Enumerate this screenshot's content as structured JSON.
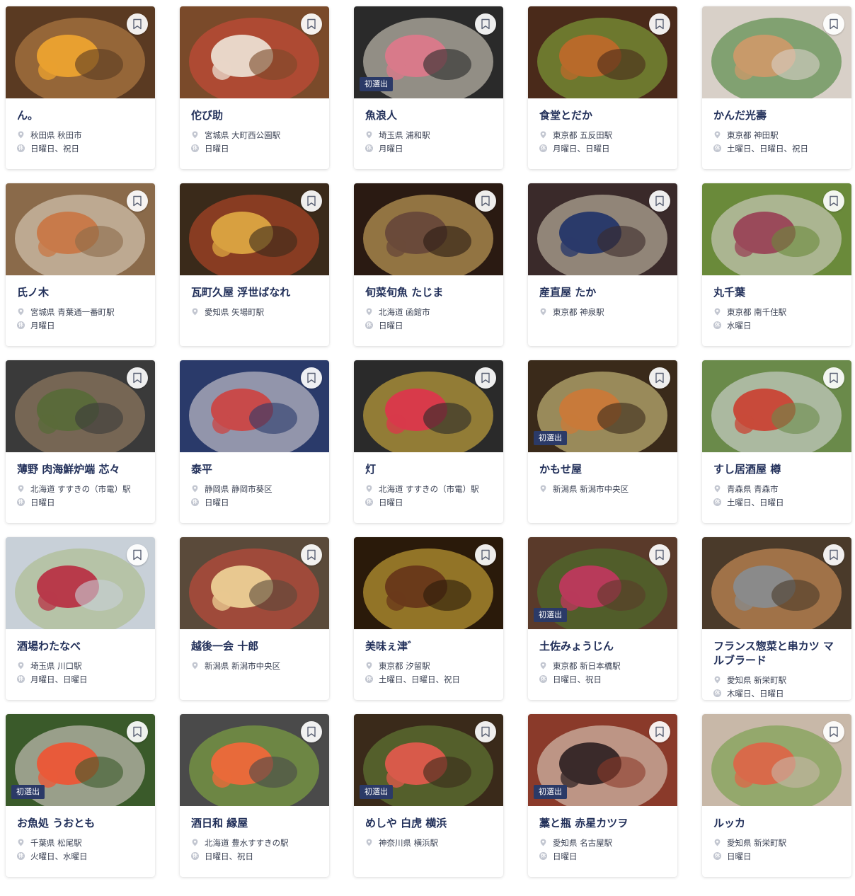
{
  "icons": {
    "bookmark": "bookmark-icon",
    "location": "location-pin-icon",
    "holiday": "holiday-icon",
    "holiday_char": "休"
  },
  "colors": {
    "accent": "#22305a",
    "badge": "#2b3a67",
    "icon_gray": "#c3c7d1"
  },
  "restaurants": [
    {
      "name": "ん。",
      "location": "秋田県 秋田市",
      "holiday": "日曜日、祝日",
      "badge": "",
      "photo": [
        "#5a3a22",
        "#e8a030",
        "#c78a4a"
      ]
    },
    {
      "name": "佗び助",
      "location": "宮城県 大町西公園駅",
      "holiday": "日曜日",
      "badge": "",
      "photo": [
        "#7a4a2a",
        "#e8d6c8",
        "#d84a3a"
      ]
    },
    {
      "name": "魚浪人",
      "location": "埼玉県 浦和駅",
      "holiday": "月曜日",
      "badge": "初選出",
      "photo": [
        "#2a2a2a",
        "#d87a8a",
        "#e8e0d0"
      ]
    },
    {
      "name": "食堂とだか",
      "location": "東京都 五反田駅",
      "holiday": "月曜日、日曜日",
      "badge": "",
      "photo": [
        "#4a2a1a",
        "#b86a2a",
        "#8ab840"
      ]
    },
    {
      "name": "かんだ光壽",
      "location": "東京都 神田駅",
      "holiday": "土曜日、日曜日、祝日",
      "badge": "",
      "photo": [
        "#d8d0c8",
        "#c89a6a",
        "#3a7a2a"
      ]
    },
    {
      "name": "氏ノ木",
      "location": "宮城県 青葉通一番町駅",
      "holiday": "月曜日",
      "badge": "",
      "photo": [
        "#8a6a4a",
        "#c87a4a",
        "#e8dccc"
      ]
    },
    {
      "name": "瓦町久屋 浮世ばなれ",
      "location": "愛知県 矢場町駅",
      "holiday": "",
      "badge": "",
      "photo": [
        "#3a2a1a",
        "#d8a040",
        "#c84a2a"
      ]
    },
    {
      "name": "旬菜旬魚 たじま",
      "location": "北海道 函館市",
      "holiday": "日曜日",
      "badge": "",
      "photo": [
        "#2a1a12",
        "#6a4a3a",
        "#e8c06a"
      ]
    },
    {
      "name": "産直屋 たか",
      "location": "東京都 神泉駅",
      "holiday": "",
      "badge": "",
      "photo": [
        "#3a2a2a",
        "#2a3a6a",
        "#d8d0b8"
      ]
    },
    {
      "name": "丸千葉",
      "location": "東京都 南千住駅",
      "holiday": "水曜日",
      "badge": "",
      "photo": [
        "#6a8a3a",
        "#9a4a5a",
        "#e0d8d8"
      ]
    },
    {
      "name": "薄野 肉海鮮炉端 芯々",
      "location": "北海道 すすきの（市電）駅",
      "holiday": "日曜日",
      "badge": "",
      "photo": [
        "#3a3a3a",
        "#5a6a3a",
        "#a88a6a"
      ]
    },
    {
      "name": "泰平",
      "location": "静岡県 静岡市葵区",
      "holiday": "日曜日",
      "badge": "",
      "photo": [
        "#2a3a6a",
        "#c84a4a",
        "#e8e0e0"
      ]
    },
    {
      "name": "灯",
      "location": "北海道 すすきの（市電）駅",
      "holiday": "日曜日",
      "badge": "",
      "photo": [
        "#2a2a2a",
        "#d83a4a",
        "#e8c040"
      ]
    },
    {
      "name": "かもせ屋",
      "location": "新潟県 新潟市中央区",
      "holiday": "",
      "badge": "初選出",
      "photo": [
        "#3a2a1a",
        "#c87a3a",
        "#e8d890"
      ]
    },
    {
      "name": "すし居酒屋 樽",
      "location": "青森県 青森市",
      "holiday": "土曜日、日曜日",
      "badge": "",
      "photo": [
        "#6a8a4a",
        "#c84a3a",
        "#e0e0e8"
      ]
    },
    {
      "name": "酒場わたなべ",
      "location": "埼玉県 川口駅",
      "holiday": "月曜日、日曜日",
      "badge": "",
      "photo": [
        "#c8d0d8",
        "#b83a4a",
        "#a8b880"
      ]
    },
    {
      "name": "越後一会 十郎",
      "location": "新潟県 新潟市中央区",
      "holiday": "",
      "badge": "",
      "photo": [
        "#5a4a3a",
        "#e8c890",
        "#d84a3a"
      ]
    },
    {
      "name": "美味ぇ津゛",
      "location": "東京都 汐留駅",
      "holiday": "土曜日、日曜日、祝日",
      "badge": "",
      "photo": [
        "#2a1a0a",
        "#6a3a1a",
        "#e8c040"
      ]
    },
    {
      "name": "土佐みょうじん",
      "location": "東京都 新日本橋駅",
      "holiday": "日曜日、祝日",
      "badge": "初選出",
      "photo": [
        "#5a3a2a",
        "#b83a5a",
        "#4a7a2a"
      ]
    },
    {
      "name": "フランス惣菜と串カツ マルブラード",
      "location": "愛知県 新栄町駅",
      "holiday": "木曜日、日曜日",
      "badge": "",
      "photo": [
        "#4a3a2a",
        "#8a8a8a",
        "#e8a060"
      ]
    },
    {
      "name": "お魚処 うおとも",
      "location": "千葉県 松尾駅",
      "holiday": "火曜日、水曜日",
      "badge": "初選出",
      "photo": [
        "#3a5a2a",
        "#e85a3a",
        "#e8d8d8"
      ]
    },
    {
      "name": "酒日和 縁屋",
      "location": "北海道 豊水すすきの駅",
      "holiday": "日曜日、祝日",
      "badge": "",
      "photo": [
        "#4a4a4a",
        "#e86a3a",
        "#8ab840"
      ]
    },
    {
      "name": "めしや 白虎 横浜",
      "location": "神奈川県 横浜駅",
      "holiday": "",
      "badge": "初選出",
      "photo": [
        "#3a2a1a",
        "#d85a4a",
        "#6a8a3a"
      ]
    },
    {
      "name": "藁と瓶 赤星カツヲ",
      "location": "愛知県 名古屋駅",
      "holiday": "日曜日",
      "badge": "初選出",
      "photo": [
        "#8a3a2a",
        "#3a2a2a",
        "#e8e0d0"
      ]
    },
    {
      "name": "ルッカ",
      "location": "愛知県 新栄町駅",
      "holiday": "日曜日",
      "badge": "",
      "photo": [
        "#c8b8a8",
        "#d86a4a",
        "#6a9a3a"
      ]
    }
  ]
}
